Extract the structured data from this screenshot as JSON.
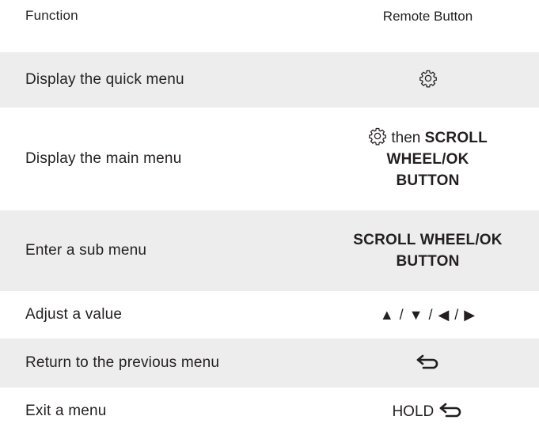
{
  "header": {
    "function_label": "Function",
    "button_label": "Remote Button"
  },
  "rows": [
    {
      "function": "Display the quick menu",
      "button_icon": "gear-icon"
    },
    {
      "function": "Display the main menu",
      "button_icon": "gear-icon",
      "button_text_then": "then",
      "button_text_bold_1": "SCROLL",
      "button_text_bold_2": "WHEEL/OK",
      "button_text_bold_3": "BUTTON"
    },
    {
      "function": "Enter a sub menu",
      "button_text_bold_1": "SCROLL WHEEL/OK",
      "button_text_bold_2": "BUTTON"
    },
    {
      "function": "Adjust a value",
      "button_text": "▲ / ▼ / ◀ / ▶"
    },
    {
      "function": "Return to the previous menu",
      "button_icon": "back-arrow-icon"
    },
    {
      "function": "Exit a menu",
      "button_text": "HOLD",
      "button_icon": "back-arrow-icon"
    }
  ],
  "colors": {
    "row_shade": "#ededed",
    "text": "#231f20"
  }
}
